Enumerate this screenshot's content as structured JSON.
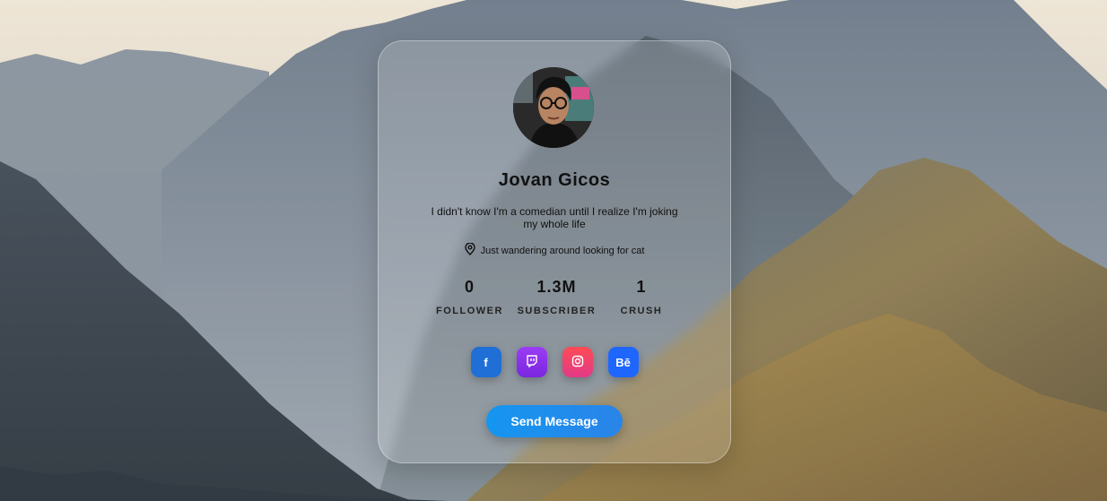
{
  "profile": {
    "name": "Jovan Gicos",
    "bio": "I didn't know I'm a comedian until I realize I'm joking my whole life",
    "location": "Just wandering around looking for cat"
  },
  "stats": [
    {
      "value": "0",
      "label": "FOLLOWER"
    },
    {
      "value": "1.3M",
      "label": "SUBSCRIBER"
    },
    {
      "value": "1",
      "label": "CRUSH"
    }
  ],
  "socials": [
    {
      "icon": "facebook-icon",
      "label": "f"
    },
    {
      "icon": "twitch-icon",
      "label": ""
    },
    {
      "icon": "instagram-icon",
      "label": ""
    },
    {
      "icon": "behance-icon",
      "label": "Bē"
    }
  ],
  "actions": {
    "send_message": "Send Message"
  },
  "colors": {
    "primary": "#1f86ea",
    "twitch": "#8a34f0",
    "instagram": "#ee4468",
    "behance": "#1f66ff"
  }
}
